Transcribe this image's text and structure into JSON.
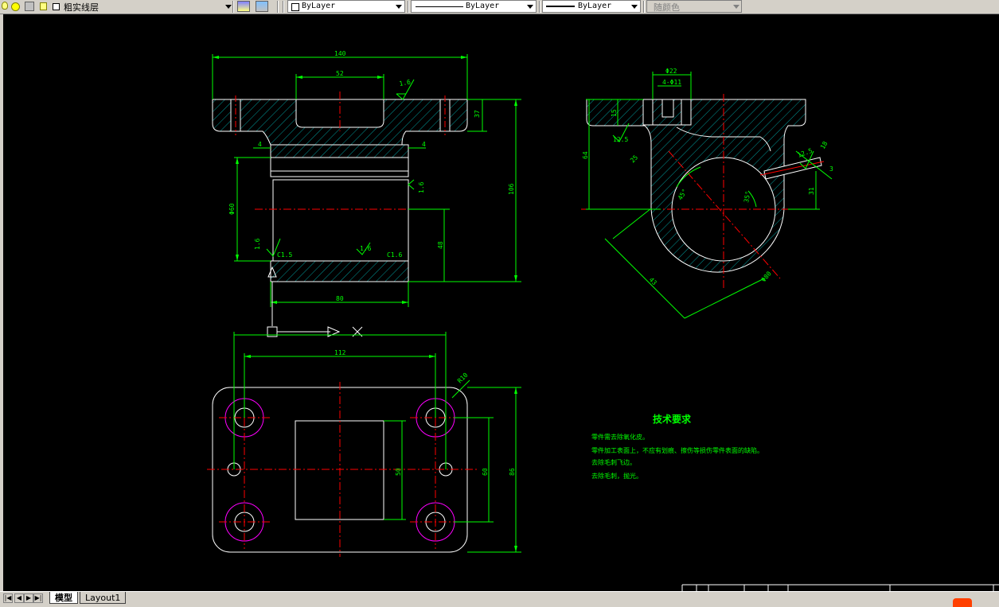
{
  "toolbar": {
    "layer_name": "粗实线层",
    "color_value": "ByLayer",
    "linetype_value": "ByLayer",
    "lineweight_value": "ByLayer",
    "plotstyle_value": "随颜色"
  },
  "tabs": {
    "model": "模型",
    "layout1": "Layout1"
  },
  "drawing": {
    "dims": {
      "d140": "140",
      "d52": "52",
      "d37": "37",
      "d4a": "4",
      "d4b": "4",
      "d106": "106",
      "phi60": "Φ60",
      "d48": "48",
      "d80": "80",
      "c15": "C1.5",
      "c16": "C1.6",
      "r16a": "1.6",
      "r16b": "1.6",
      "r16c": "1.6",
      "r16d": "1.6",
      "d112": "112",
      "r10": "R10",
      "d50": "50",
      "d60": "60",
      "d86": "86",
      "phi22": "Φ22",
      "phi11": "4-Φ11",
      "d15": "15",
      "d125a": "12.5",
      "d125b": "12.5",
      "d64": "64",
      "d45": "45°",
      "d35": "35°",
      "d31": "31",
      "d43": "43",
      "phi80": "Φ80",
      "d25": "25",
      "d18": "18",
      "d3": "3"
    },
    "tech_title": "技术要求",
    "tech_notes": [
      "零件需去除氧化皮。",
      "零件加工表面上，不应有划痕、擦伤等损伤零件表面的缺陷。",
      "去除毛刺飞边。",
      "去除毛刺，抛光。"
    ]
  },
  "colors": {
    "outline": "#ffffff",
    "dimension": "#00ff00",
    "centerline": "#ff0000",
    "hatch": "#00c0c0",
    "bolt_circle": "#ff00ff",
    "text": "#00ff00"
  }
}
